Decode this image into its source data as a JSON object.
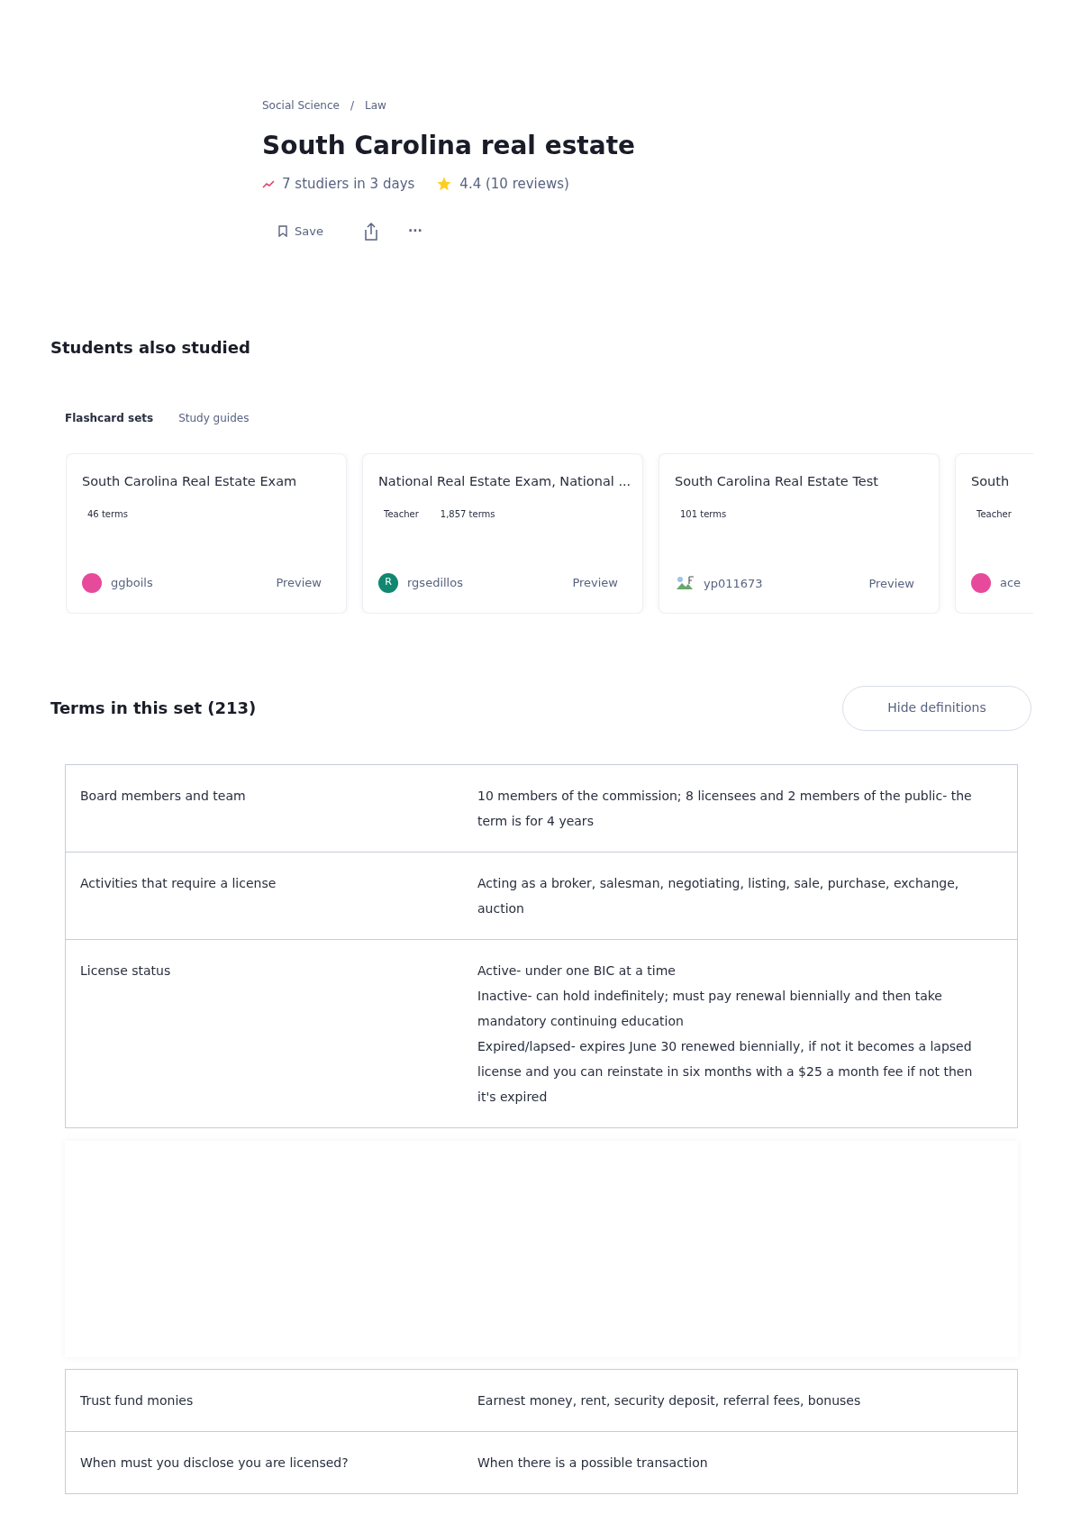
{
  "breadcrumb": [
    "Social Science",
    "Law"
  ],
  "breadcrumb_separator": "/",
  "title": "South Carolina real estate",
  "stats": {
    "studiers": "7 studiers in 3 days",
    "rating": "4.4 (10 reviews)"
  },
  "actions": {
    "save": "Save",
    "more": "···"
  },
  "also_studied": {
    "heading": "Students also studied",
    "tabs": [
      {
        "label": "Flashcard sets",
        "selected": true
      },
      {
        "label": "Study guides",
        "selected": false
      }
    ],
    "cards": [
      {
        "title": "South Carolina Real Estate Exam",
        "terms": "46 terms",
        "avatar": {
          "kind": "photo",
          "color": "#e84a9b"
        },
        "user": "ggboils",
        "preview": "Preview"
      },
      {
        "title": "National Real Estate Exam, National ...",
        "teacher": "Teacher",
        "terms": "1,857 terms",
        "avatar": {
          "kind": "letter",
          "letter": "R",
          "color": "#12876f"
        },
        "user": "rgsedillos",
        "preview": "Preview"
      },
      {
        "title": "South Carolina Real Estate Test",
        "terms": "101 terms",
        "avatar": {
          "kind": "broken"
        },
        "user": "yp011673",
        "preview": "Preview"
      },
      {
        "title": "South",
        "teacher": "Teacher",
        "avatar": {
          "kind": "photo",
          "color": "#e84a9b"
        },
        "user": "ace"
      }
    ]
  },
  "terms": {
    "heading": "Terms in this set (213)",
    "toggle": "Hide definitions",
    "rows": [
      {
        "kind": "term",
        "term": "Board members and team",
        "definition": "10 members of the commission; 8 licensees and 2 members of the public- the term is for 4 years"
      },
      {
        "kind": "term",
        "term": "Activities that require a license",
        "definition": "Acting as a broker, salesman, negotiating, listing, sale, purchase, exchange, auction"
      },
      {
        "kind": "term",
        "term": "License status",
        "definition": "Active- under one BIC at a time\nInactive- can hold indefinitely; must pay renewal biennially and then take mandatory continuing education\nExpired/lapsed- expires June 30 renewed biennially, if not it becomes a lapsed license and you can reinstate in six months with a $25 a month fee if not then it's expired"
      },
      {
        "kind": "ad"
      },
      {
        "kind": "term",
        "term": "Trust fund monies",
        "definition": "Earnest money, rent, security deposit, referral fees, bonuses"
      },
      {
        "kind": "term",
        "term": "When must you disclose you are licensed?",
        "definition": "When there is a possible transaction"
      }
    ]
  }
}
